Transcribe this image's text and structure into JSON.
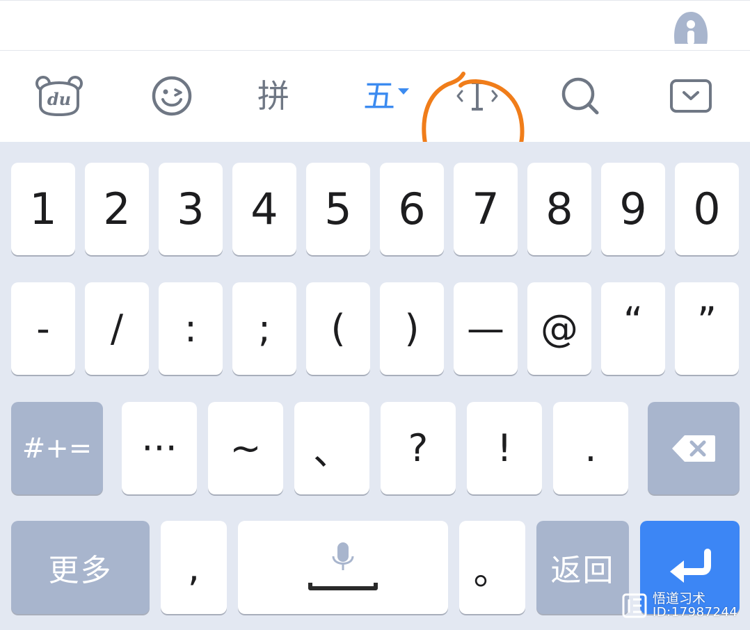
{
  "toolbar": {
    "logo_text": "du",
    "pinyin_label": "拼",
    "wubi_label": "五",
    "cursor_label": "‹I›"
  },
  "icons": {
    "assistant": "assistant-icon",
    "logo": "baidu-bear-logo-icon",
    "emoji": "emoji-icon",
    "cursor": "cursor-move-icon",
    "search": "search-icon",
    "hide_keyboard": "hide-keyboard-icon",
    "backspace": "backspace-icon",
    "microphone": "microphone-icon",
    "enter": "enter-icon"
  },
  "colors": {
    "accent": "#3c8bf0",
    "key_dark": "#a8b5cd",
    "keyboard_bg": "#e3e8f2",
    "annotation": "#f07d1a"
  },
  "keyboard": {
    "row1": [
      "1",
      "2",
      "3",
      "4",
      "5",
      "6",
      "7",
      "8",
      "9",
      "0"
    ],
    "row2": [
      "-",
      "/",
      ":",
      ";",
      "(",
      ")",
      "—",
      "@",
      "“",
      "”"
    ],
    "row3": {
      "shift_label": "#+=",
      "keys": [
        "···",
        "~",
        "、",
        "?",
        "!",
        "."
      ]
    },
    "row4": {
      "more_label": "更多",
      "comma": ",",
      "period": "。",
      "back_label": "返回"
    }
  },
  "watermark": {
    "name": "悟道习术",
    "id": "ID:17987244"
  }
}
